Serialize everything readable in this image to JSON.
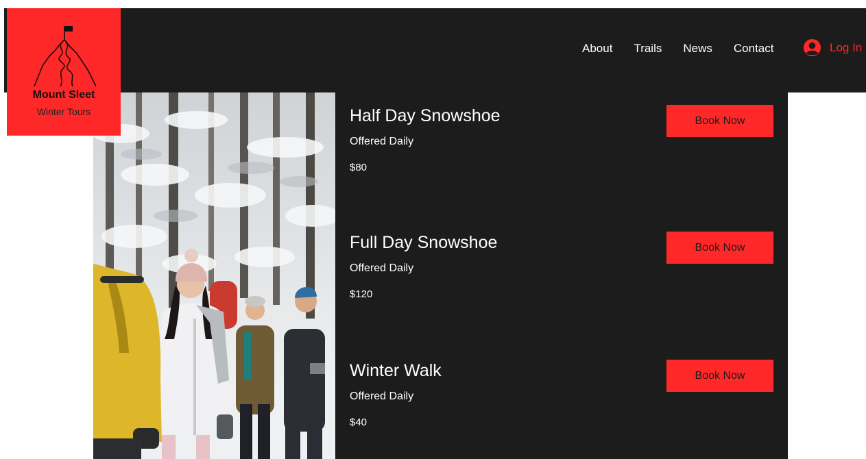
{
  "brand": {
    "name": "Mount Sleet",
    "tagline": "Winter Tours",
    "icon": "mountain-flag-icon",
    "color": "#fe2828"
  },
  "nav": {
    "items": [
      "About",
      "Trails",
      "News",
      "Contact"
    ],
    "login_label": "Log In",
    "login_icon": "user-avatar-icon"
  },
  "tours": [
    {
      "name": "Half Day Snowshoe",
      "frequency": "Offered Daily",
      "price": "$80",
      "button": "Book Now"
    },
    {
      "name": "Full Day Snowshoe",
      "frequency": "Offered Daily",
      "price": "$120",
      "button": "Book Now"
    },
    {
      "name": "Winter Walk",
      "frequency": "Offered Daily",
      "price": "$40",
      "button": "Book Now"
    }
  ],
  "colors": {
    "background": "#1c1c1c",
    "accent": "#fe2828",
    "text": "#ffffff"
  }
}
